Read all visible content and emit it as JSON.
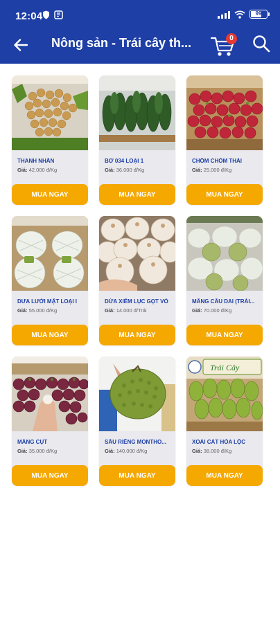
{
  "status_bar": {
    "time": "12:04",
    "battery": "99"
  },
  "header": {
    "title": "Nông sản - Trái cây th...",
    "cart_count": "0"
  },
  "products": [
    {
      "name": "THANH NHÃN",
      "price_label": "Giá:",
      "price": "42.000 đ/Kg",
      "button": "MUA NGAY"
    },
    {
      "name": "BƠ 034 LOẠI 1",
      "price_label": "Giá:",
      "price": "36.000 đ/Kg",
      "button": "MUA NGAY"
    },
    {
      "name": "CHÔM CHÔM THÁI",
      "price_label": "Giá:",
      "price": "25.000 đ/Kg",
      "button": "MUA NGAY"
    },
    {
      "name": "DƯA LƯỚI MẬT LOẠI I",
      "price_label": "Giá:",
      "price": "55.000 đ/Kg",
      "button": "MUA NGAY"
    },
    {
      "name": "DỪA XIÊM LỤC GỌT VỎ",
      "price_label": "Giá:",
      "price": "14.000 đ/Trái",
      "button": "MUA NGAY"
    },
    {
      "name": "MÃNG CẦU DAI (TRÁI...",
      "price_label": "Giá:",
      "price": "70.000 đ/Kg",
      "button": "MUA NGAY"
    },
    {
      "name": "MĂNG CỤT",
      "price_label": "Giá:",
      "price": "35.000 đ/Kg",
      "button": "MUA NGAY"
    },
    {
      "name": "SẦU RIÊNG MONTHO...",
      "price_label": "Giá:",
      "price": "140.000 đ/Kg",
      "button": "MUA NGAY"
    },
    {
      "name": "XOÀI CÁT HÒA LỘC",
      "price_label": "Giá:",
      "price": "38.000 đ/Kg",
      "button": "MUA NGAY"
    }
  ],
  "photo_signage": {
    "fruit_sign": "Trái Cây"
  },
  "colors": {
    "header": "#1e3fa6",
    "button": "#f5a800",
    "badge": "#e53935",
    "card": "#e9e9ee",
    "name_text": "#1e3fa6"
  },
  "icons": [
    "back-arrow-icon",
    "cart-icon",
    "search-icon",
    "wifi-icon",
    "signal-icon",
    "battery-icon"
  ]
}
